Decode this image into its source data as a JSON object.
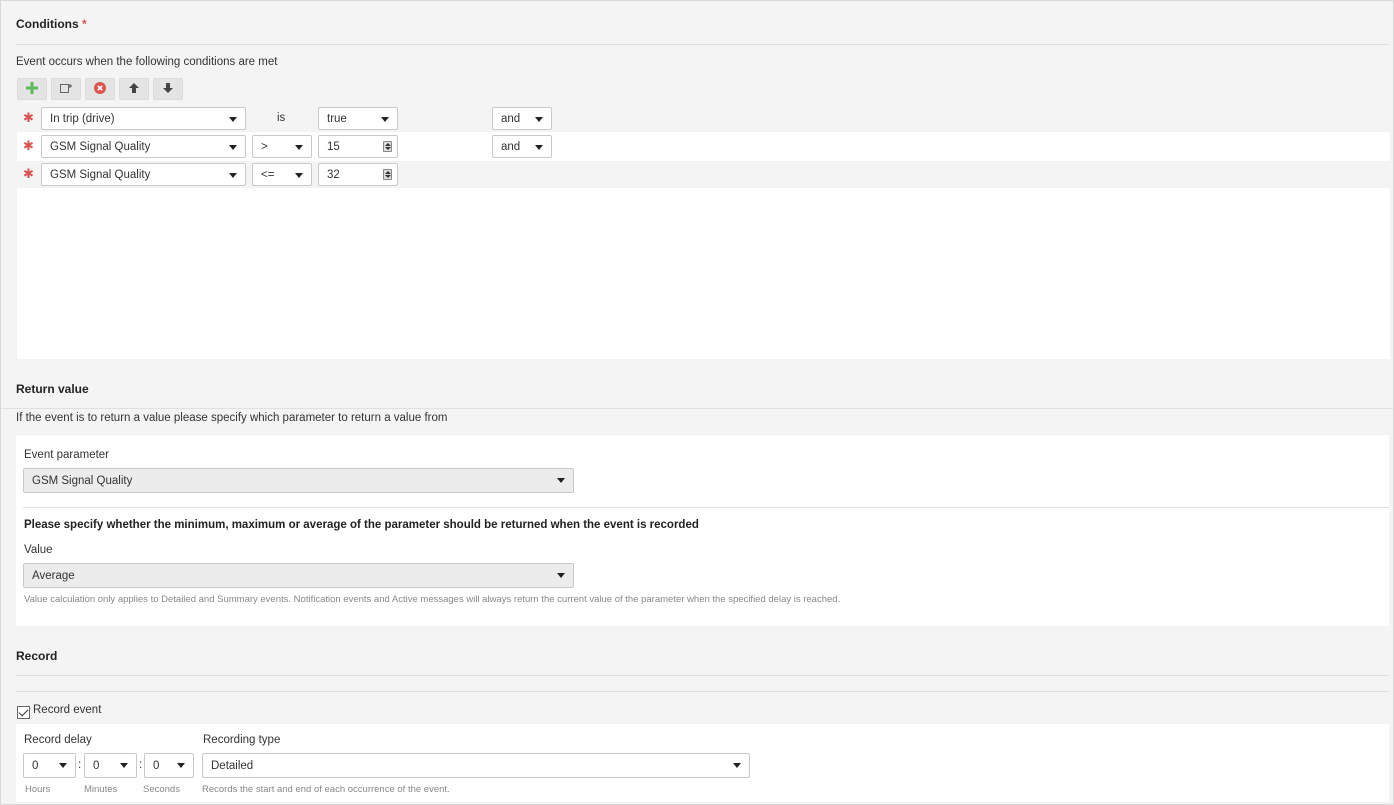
{
  "conditions": {
    "title": "Conditions",
    "required_mark": "*",
    "description": "Event occurs when the following conditions are met",
    "toolbar": {
      "add_icon": "plus-icon",
      "add_group_icon": "add-group-icon",
      "remove_icon": "remove-icon",
      "up_icon": "arrow-up-icon",
      "down_icon": "arrow-down-icon"
    },
    "rows": [
      {
        "mark": "✱",
        "parameter": "In trip (drive)",
        "operator": "is",
        "value": "true",
        "join": "and"
      },
      {
        "mark": "✱",
        "parameter": "GSM Signal Quality",
        "operator": ">",
        "value": "15",
        "join": "and"
      },
      {
        "mark": "✱",
        "parameter": "GSM Signal Quality",
        "operator": "<=",
        "value": "32",
        "join": ""
      }
    ]
  },
  "return_value": {
    "title": "Return value",
    "description": "If the event is to return a value please specify which parameter to return a value from",
    "event_parameter_label": "Event parameter",
    "event_parameter_value": "GSM Signal Quality",
    "question": "Please specify whether the minimum, maximum or average of the parameter should be returned when the event is recorded",
    "value_label": "Value",
    "value_selected": "Average",
    "note": "Value calculation only applies to Detailed and Summary events. Notification events and Active messages will always return the current value of the parameter when the specified delay is reached."
  },
  "record": {
    "title": "Record",
    "record_event_label": "Record event",
    "record_event_checked": true,
    "delay_label": "Record delay",
    "hours": "0",
    "minutes": "0",
    "seconds": "0",
    "sep": ":",
    "hours_label": "Hours",
    "minutes_label": "Minutes",
    "seconds_label": "Seconds",
    "recording_type_label": "Recording type",
    "recording_type_value": "Detailed",
    "recording_type_help": "Records the start and end of each occurrence of the event."
  },
  "colors": {
    "required": "#d9534f",
    "add_green": "#5cb85c",
    "remove_red": "#d9534f"
  }
}
